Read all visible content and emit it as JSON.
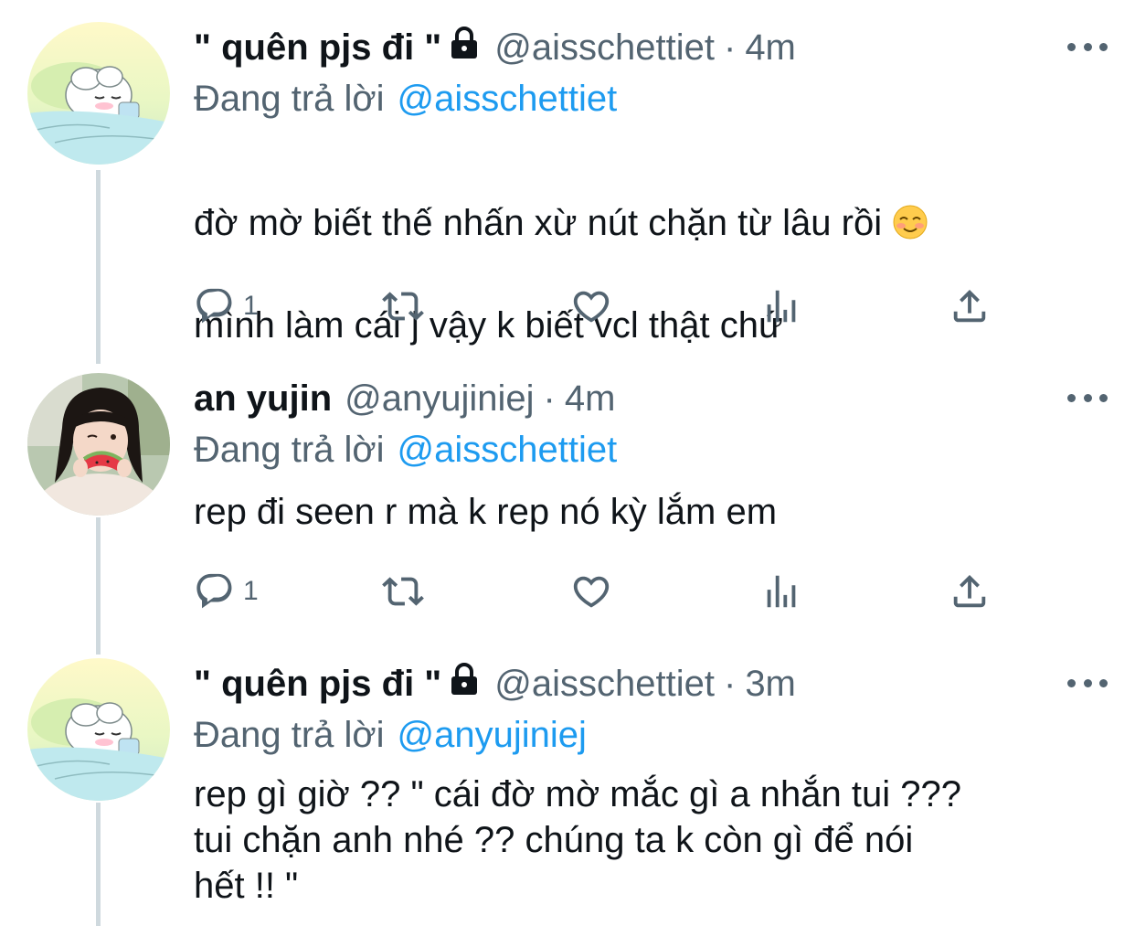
{
  "tweets": [
    {
      "name": "\" quên pjs đi \"",
      "locked": true,
      "handle": "@aisschettiet",
      "separator": "·",
      "time": "4m",
      "reply_label": "Đang trả lời",
      "reply_mention": "@aisschettiet",
      "text_line1": "đờ mờ biết thế nhấn xừ nút chặn từ lâu rồi",
      "emoji": "smiling-blush",
      "text_line2": "mình làm cái j vậy k biết vcl thật chứ",
      "reply_count": "1"
    },
    {
      "name": "an yujin",
      "locked": false,
      "handle": "@anyujiniej",
      "separator": "·",
      "time": "4m",
      "reply_label": "Đang trả lời",
      "reply_mention": "@aisschettiet",
      "text": "rep đi seen r mà k rep nó kỳ lắm em",
      "reply_count": "1"
    },
    {
      "name": "\" quên pjs đi \"",
      "locked": true,
      "handle": "@aisschettiet",
      "separator": "·",
      "time": "3m",
      "reply_label": "Đang trả lời",
      "reply_mention": "@anyujiniej",
      "text": "rep gì giờ ?? \" cái đờ mờ mắc gì a nhắn tui ???\ntui chặn anh nhé ?? chúng ta k còn gì để nói\nhết !! \""
    }
  ],
  "colors": {
    "text": "#0f1419",
    "secondary": "#536471",
    "link": "#1d9bf0",
    "thread_line": "#cfd9de"
  },
  "icons": [
    "lock-icon",
    "more-icon",
    "reply-icon",
    "retweet-icon",
    "like-icon",
    "views-icon",
    "share-icon"
  ]
}
